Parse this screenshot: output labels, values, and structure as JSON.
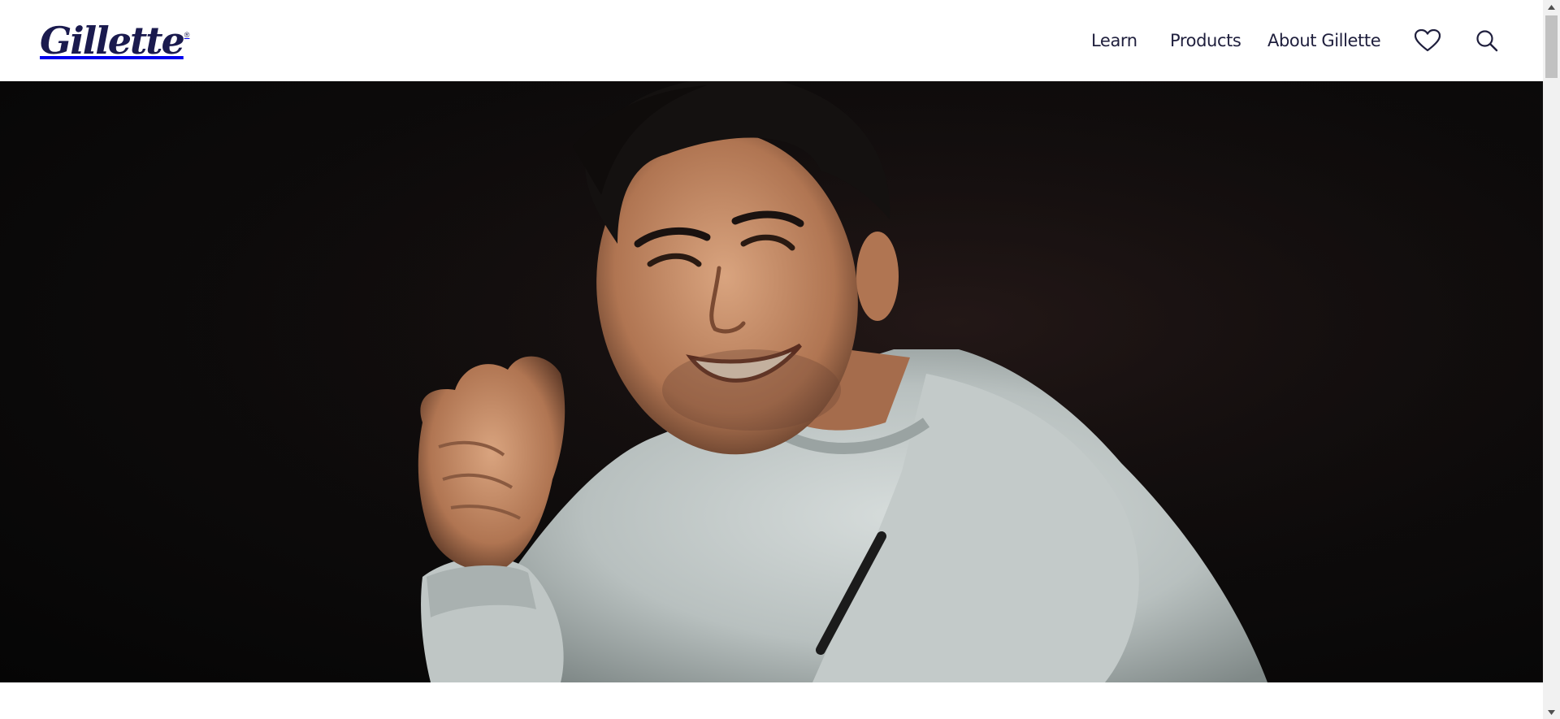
{
  "brand": {
    "logo_text": "Gillette",
    "color": "#1a1a4e"
  },
  "nav": {
    "items": [
      {
        "label": "Learn"
      },
      {
        "label": "Products"
      },
      {
        "label": "About Gillette"
      }
    ],
    "icons": [
      "heart-icon",
      "search-icon"
    ]
  },
  "hero": {
    "image_description": "smiling man in light grey sweatshirt against dark background",
    "background_color": "#0a0909",
    "sweatshirt_color": "#c9d0cf"
  },
  "colors": {
    "nav_text": "#1f1f3d",
    "header_bg": "#ffffff"
  }
}
